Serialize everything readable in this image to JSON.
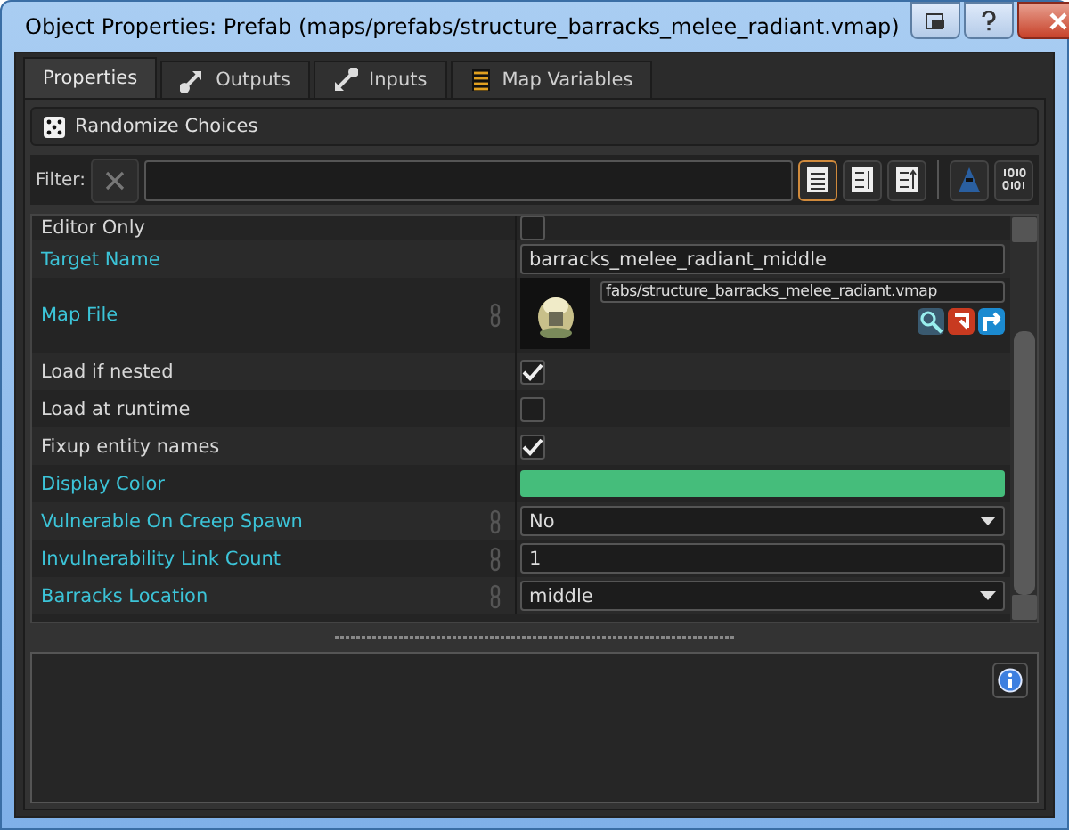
{
  "window": {
    "title": "Object Properties: Prefab (maps/prefabs/structure_barracks_melee_radiant.vmap)"
  },
  "tabs": [
    {
      "label": "Properties",
      "selected": true
    },
    {
      "label": "Outputs",
      "selected": false
    },
    {
      "label": "Inputs",
      "selected": false
    },
    {
      "label": "Map Variables",
      "selected": false
    }
  ],
  "randomize_button": {
    "label": "Randomize Choices"
  },
  "filter": {
    "label": "Filter:",
    "view_buttons": [
      {
        "selected": true
      },
      {
        "selected": false
      },
      {
        "selected": false
      }
    ]
  },
  "properties": [
    {
      "name": "Editor Only",
      "kind": "checkbox",
      "modified": false,
      "linked": false,
      "checked": false
    },
    {
      "name": "Target Name",
      "kind": "text",
      "modified": true,
      "linked": false,
      "value": "barracks_melee_radiant_middle"
    },
    {
      "name": "Map File",
      "kind": "file",
      "modified": true,
      "linked": true,
      "value": "fabs/structure_barracks_melee_radiant.vmap"
    },
    {
      "name": "Load if nested",
      "kind": "checkbox",
      "modified": false,
      "linked": false,
      "checked": true
    },
    {
      "name": "Load at runtime",
      "kind": "checkbox",
      "modified": false,
      "linked": false,
      "checked": false
    },
    {
      "name": "Fixup entity names",
      "kind": "checkbox",
      "modified": false,
      "linked": false,
      "checked": true
    },
    {
      "name": "Display Color",
      "kind": "color",
      "modified": true,
      "linked": false,
      "color": "#45bd7b"
    },
    {
      "name": "Vulnerable On Creep Spawn",
      "kind": "dropdown",
      "modified": true,
      "linked": true,
      "value": "No"
    },
    {
      "name": "Invulnerability Link Count",
      "kind": "text",
      "modified": true,
      "linked": true,
      "value": "1"
    },
    {
      "name": "Barracks Location",
      "kind": "dropdown",
      "modified": true,
      "linked": true,
      "value": "middle"
    }
  ]
}
